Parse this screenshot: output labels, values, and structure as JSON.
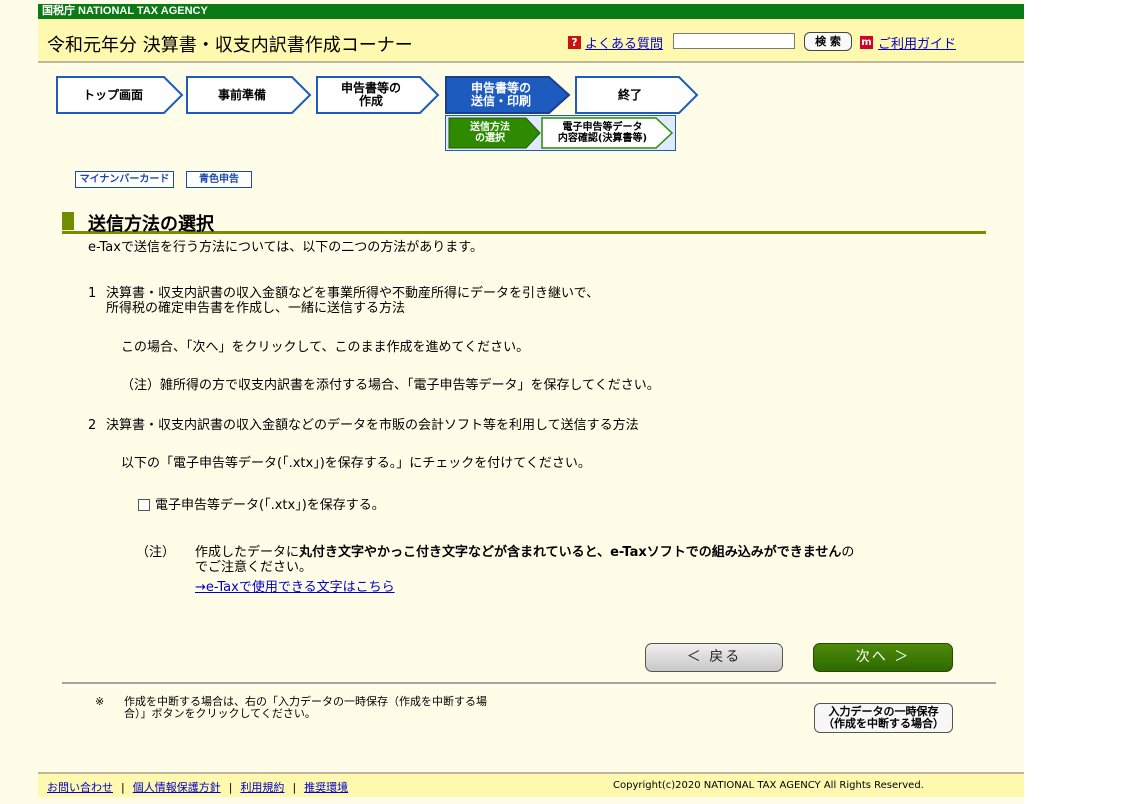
{
  "agency_bar": {
    "text": "国税庁  NATIONAL TAX AGENCY"
  },
  "header": {
    "title": "令和元年分 決算書・収支内訳書作成コーナー",
    "faq_icon": "?",
    "faq_link": "よくある質問",
    "search_value": "",
    "search_button": "検 索",
    "guide_icon": "m",
    "guide_link": "ご利用ガイド"
  },
  "steps": [
    {
      "label": "トップ画面",
      "state": "done"
    },
    {
      "label": "事前準備",
      "state": "done"
    },
    {
      "label": "申告書等の\n作成",
      "state": "done"
    },
    {
      "label": "申告書等の\n送信・印刷",
      "state": "current"
    },
    {
      "label": "終了",
      "state": "todo"
    }
  ],
  "substeps": [
    {
      "label": "送信方法\nの選択",
      "state": "current"
    },
    {
      "label": "電子申告等データ\n内容確認(決算書等)",
      "state": "todo"
    }
  ],
  "tags": {
    "mynumber": "マイナンバーカード",
    "blue": "青色申告"
  },
  "section": {
    "title": "送信方法の選択",
    "intro": "e-Taxで送信を行う方法については、以下の二つの方法があります。",
    "item1_num": "1",
    "item1_line1": "決算書・収支内訳書の収入金額などを事業所得や不動産所得にデータを引き継いで、",
    "item1_line2": "所得税の確定申告書を作成し、一緒に送信する方法",
    "item1_desc": "この場合、「次へ」をクリックして、このまま作成を進めてください。",
    "item1_note": "（注）雑所得の方で収支内訳書を添付する場合、「電子申告等データ」を保存してください。",
    "item2_num": "2",
    "item2_line": "決算書・収支内訳書の収入金額などのデータを市販の会計ソフト等を利用して送信する方法",
    "item2_desc": "以下の「電子申告等データ(「.xtx」)を保存する。」にチェックを付けてください。",
    "checkbox_label": "電子申告等データ(「.xtx」)を保存する。",
    "note_prefix": "（注）",
    "note_line1_a": "作成したデータに",
    "note_line1_b": "丸付き文字やかっこ付き文字などが含まれていると、e-Taxソフトでの組み込みができません",
    "note_line1_c": "の",
    "note_line2": "でご注意ください。",
    "note_link": "→e-Taxで使用できる文字はこちら"
  },
  "buttons": {
    "back": "＜ 戻る",
    "next": "次へ ＞"
  },
  "bottom_note": {
    "star": "※",
    "line1": "作成を中断する場合は、右の「入力データの一時保存（作成を中断する場",
    "line2": "合）」ボタンをクリックしてください。",
    "save_line1": "入力データの一時保存",
    "save_line2": "（作成を中断する場合）"
  },
  "footer": {
    "links": [
      "お問い合わせ",
      "個人情報保護方針",
      "利用規約",
      "推奨環境"
    ],
    "copyright": "Copyright(c)2020 NATIONAL TAX AGENCY All Rights Reserved."
  },
  "colors": {
    "agency_bar": "#0a7a14",
    "header_bg": "#fff9b0",
    "page_bg": "#fffde7",
    "step_todo_fill": "#ffffff",
    "step_todo_border": "#1e5bbf",
    "step_current_fill": "#1e5bbf",
    "substep_current_fill": "#2e8a00",
    "accent_green": "#6e8e00",
    "link": "#0000cc"
  }
}
